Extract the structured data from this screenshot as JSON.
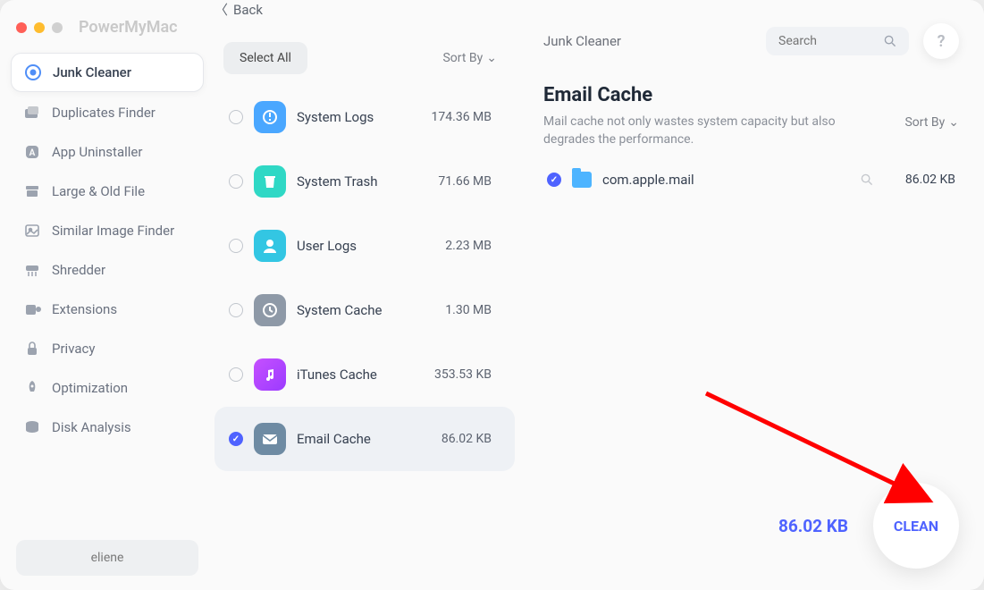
{
  "app_title": "PowerMyMac",
  "back_label": "Back",
  "breadcrumb": "Junk Cleaner",
  "search_placeholder": "Search",
  "help_label": "?",
  "user_name": "eliene",
  "sidebar": [
    {
      "id": "junk-cleaner",
      "label": "Junk Cleaner",
      "active": true
    },
    {
      "id": "duplicates-finder",
      "label": "Duplicates Finder",
      "active": false
    },
    {
      "id": "app-uninstaller",
      "label": "App Uninstaller",
      "active": false
    },
    {
      "id": "large-old-file",
      "label": "Large & Old File",
      "active": false
    },
    {
      "id": "similar-image-finder",
      "label": "Similar Image Finder",
      "active": false
    },
    {
      "id": "shredder",
      "label": "Shredder",
      "active": false
    },
    {
      "id": "extensions",
      "label": "Extensions",
      "active": false
    },
    {
      "id": "privacy",
      "label": "Privacy",
      "active": false
    },
    {
      "id": "optimization",
      "label": "Optimization",
      "active": false
    },
    {
      "id": "disk-analysis",
      "label": "Disk Analysis",
      "active": false
    }
  ],
  "middle": {
    "select_all_label": "Select All",
    "sort_by_label": "Sort By",
    "categories": [
      {
        "id": "system-logs",
        "label": "System Logs",
        "size": "174.36 MB",
        "checked": false,
        "selected": false,
        "icon_bg": "#4aa7ff"
      },
      {
        "id": "system-trash",
        "label": "System Trash",
        "size": "71.66 MB",
        "checked": false,
        "selected": false,
        "icon_bg": "#2fd8c5"
      },
      {
        "id": "user-logs",
        "label": "User Logs",
        "size": "2.23 MB",
        "checked": false,
        "selected": false,
        "icon_bg": "#33c6e3"
      },
      {
        "id": "system-cache",
        "label": "System Cache",
        "size": "1.30 MB",
        "checked": false,
        "selected": false,
        "icon_bg": "#8e99a7"
      },
      {
        "id": "itunes-cache",
        "label": "iTunes Cache",
        "size": "353.53 KB",
        "checked": false,
        "selected": false,
        "icon_bg": "linear-gradient(135deg,#c650ff,#9b3bff)"
      },
      {
        "id": "email-cache",
        "label": "Email Cache",
        "size": "86.02 KB",
        "checked": true,
        "selected": true,
        "icon_bg": "#6e8ba3"
      }
    ]
  },
  "detail": {
    "title": "Email Cache",
    "description": "Mail cache not only wastes system capacity but also degrades the performance.",
    "sort_by_label": "Sort By",
    "files": [
      {
        "name": "com.apple.mail",
        "size": "86.02 KB",
        "checked": true
      }
    ],
    "total_size": "86.02 KB",
    "clean_label": "CLEAN"
  },
  "colors": {
    "accent": "#4f63ff"
  }
}
